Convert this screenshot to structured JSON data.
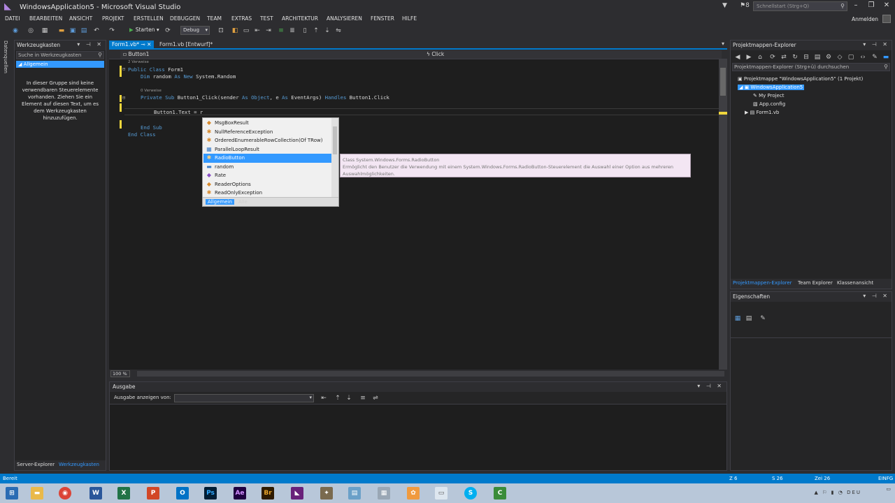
{
  "window": {
    "title": "WindowsApplication5 - Microsoft Visual Studio",
    "quick_launch_placeholder": "Schnellstart (Strg+Q)",
    "notification_count": "8"
  },
  "menu": {
    "items": [
      "DATEI",
      "BEARBEITEN",
      "ANSICHT",
      "PROJEKT",
      "ERSTELLEN",
      "DEBUGGEN",
      "TEAM",
      "EXTRAS",
      "TEST",
      "ARCHITEKTUR",
      "ANALYSIEREN",
      "FENSTER",
      "HILFE"
    ],
    "signin": "Anmelden"
  },
  "toolbar": {
    "start_label": "Starten",
    "config_value": "Debug"
  },
  "left_rail": {
    "label": "Datenquellen"
  },
  "toolbox": {
    "title": "Werkzeugkasten",
    "search_placeholder": "Suche in Werkzeugkasten",
    "group": "◢ Allgemein",
    "info": "In dieser Gruppe sind keine verwendbaren Steuerelemente vorhanden. Ziehen Sie ein Element auf diesen Text, um es dem Werkzeugkasten hinzuzufügen.",
    "tab_server": "Server-Explorer",
    "tab_toolbox": "Werkzeugkasten"
  },
  "editor": {
    "tabs": [
      {
        "label": "Form1.vb*",
        "active": true
      },
      {
        "label": "Form1.vb [Entwurf]*",
        "active": false
      }
    ],
    "nav_object": "Button1",
    "nav_member": "Click",
    "zoom": "100 %",
    "refs1": "2 Verweise",
    "refs2": "0 Verweise",
    "lines": {
      "l1_kw": "Public Class",
      "l1_name": " Form1",
      "l2_kw1": "Dim",
      "l2_mid": " random ",
      "l2_kw2": "As New",
      "l2_type": " System.Random",
      "l3_kw1": "Private Sub",
      "l3_sig": " Button1_Click(sender ",
      "l3_kw2": "As Object",
      "l3_mid": ", e ",
      "l3_kw3": "As",
      "l3_type": " EventArgs) ",
      "l3_kw4": "Handles",
      "l3_tail": " Button1.Click",
      "l4": "Button1.Text = r",
      "l5": "End Sub",
      "l6": "End Class"
    }
  },
  "intellisense": {
    "items": [
      {
        "label": "MsgBoxResult",
        "icon": "enum-icon",
        "selected": false
      },
      {
        "label": "NullReferenceException",
        "icon": "class-icon",
        "selected": false
      },
      {
        "label": "OrderedEnumerableRowCollection(Of TRow)",
        "icon": "class-icon",
        "selected": false
      },
      {
        "label": "ParallelLoopResult",
        "icon": "struct-icon",
        "selected": false
      },
      {
        "label": "RadioButton",
        "icon": "class-icon",
        "selected": true
      },
      {
        "label": "random",
        "icon": "field-icon",
        "selected": false
      },
      {
        "label": "Rate",
        "icon": "method-icon",
        "selected": false
      },
      {
        "label": "ReaderOptions",
        "icon": "enum-icon",
        "selected": false
      },
      {
        "label": "ReadOnlyException",
        "icon": "class-icon",
        "selected": false
      }
    ],
    "tab_common": "Allgemein",
    "tab_all": "Alle",
    "tooltip_line1": "Class System.Windows.Forms.RadioButton",
    "tooltip_line2": "Ermöglicht den Benutzer die Verwendung mit einem System.Windows.Forms.RadioButton-Steuerelement die Auswahl einer Option aus mehreren Auswahlmöglichkeiten."
  },
  "output": {
    "title": "Ausgabe",
    "show_from_label": "Ausgabe anzeigen von:",
    "show_from_value": ""
  },
  "explorer": {
    "title": "Projektmappen-Explorer",
    "search_placeholder": "Projektmappen-Explorer (Strg+ü) durchsuchen",
    "nodes": [
      "Projektmappe \"WindowsApplication5\" (1 Projekt)",
      "WindowsApplication5",
      "My Project",
      "App.config",
      "Form1.vb"
    ],
    "tab_explorer": "Projektmappen-Explorer",
    "tab_team": "Team Explorer",
    "tab_class": "Klassenansicht"
  },
  "properties": {
    "title": "Eigenschaften"
  },
  "status": {
    "left": "Bereit",
    "line": "Z 6",
    "col": "S 26",
    "char": "Zei 26",
    "mode": "EINFG"
  },
  "taskbar": {
    "apps": [
      "folder-icon",
      "chrome-icon",
      "word-icon",
      "excel-icon",
      "powerpoint-icon",
      "outlook-icon",
      "photoshop-icon",
      "aftereffects-icon",
      "bridge-icon",
      "visualstudio-icon",
      "gimp-icon",
      "notepad-icon",
      "calculator-icon",
      "paint-icon",
      "window-icon",
      "skype-icon",
      "camtasia-icon"
    ],
    "tray_lang": "DEU"
  },
  "colors": {
    "accent": "#007acc",
    "selection": "#3399ff",
    "editor_bg": "#1e1e1e"
  }
}
